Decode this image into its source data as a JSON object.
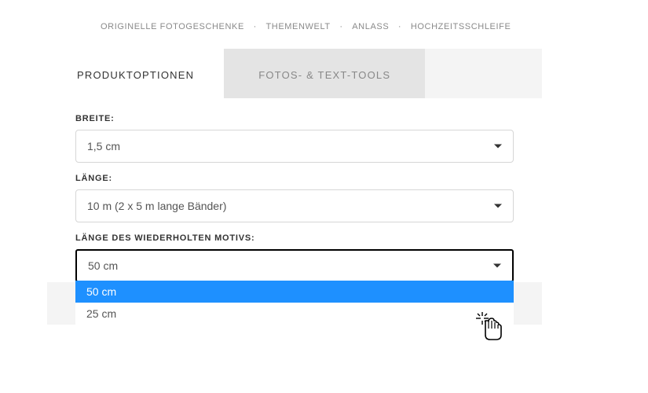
{
  "breadcrumb": {
    "items": [
      "ORIGINELLE FOTOGESCHENKE",
      "THEMENWELT",
      "ANLASS",
      "HOCHZEITSSCHLEIFE"
    ],
    "sep": "·"
  },
  "tabs": {
    "product": "PRODUKTOPTIONEN",
    "tools": "FOTOS- & TEXT-TOOLS"
  },
  "fields": {
    "breite": {
      "label": "BREITE:",
      "value": "1,5 cm"
    },
    "laenge": {
      "label": "LÄNGE:",
      "value": "10 m (2 x 5 m lange Bänder)"
    },
    "motiv": {
      "label": "LÄNGE DES WIEDERHOLTEN MOTIVS:",
      "value": "50 cm",
      "options": {
        "opt0": "50 cm",
        "opt1": "25 cm"
      }
    }
  }
}
